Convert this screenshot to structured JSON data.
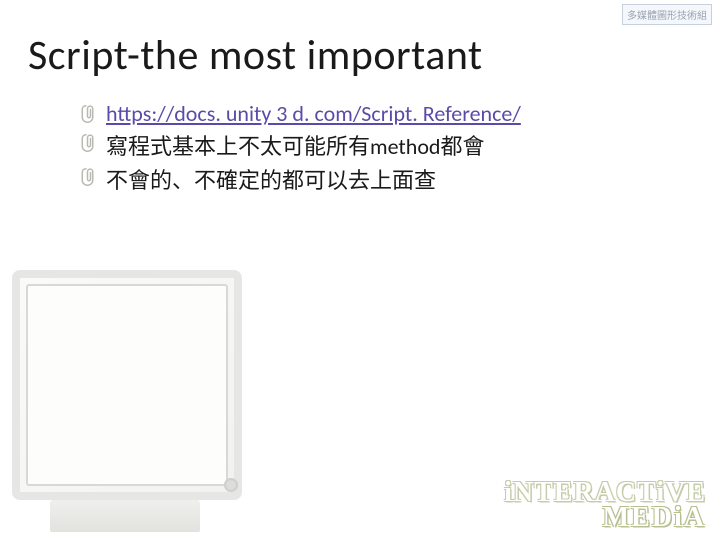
{
  "watermark": "多媒體圖形技術組",
  "title": "Script-the most important",
  "bullets": [
    {
      "type": "link",
      "text": "https://docs. unity 3 d. com/Script. Reference/"
    },
    {
      "type": "text",
      "text": "寫程式基本上不太可能所有method都會"
    },
    {
      "type": "text",
      "text": "不會的、不確定的都可以去上面查"
    }
  ],
  "branding": {
    "line1": "iNTERACTiVE",
    "line2": "MEDiA"
  }
}
